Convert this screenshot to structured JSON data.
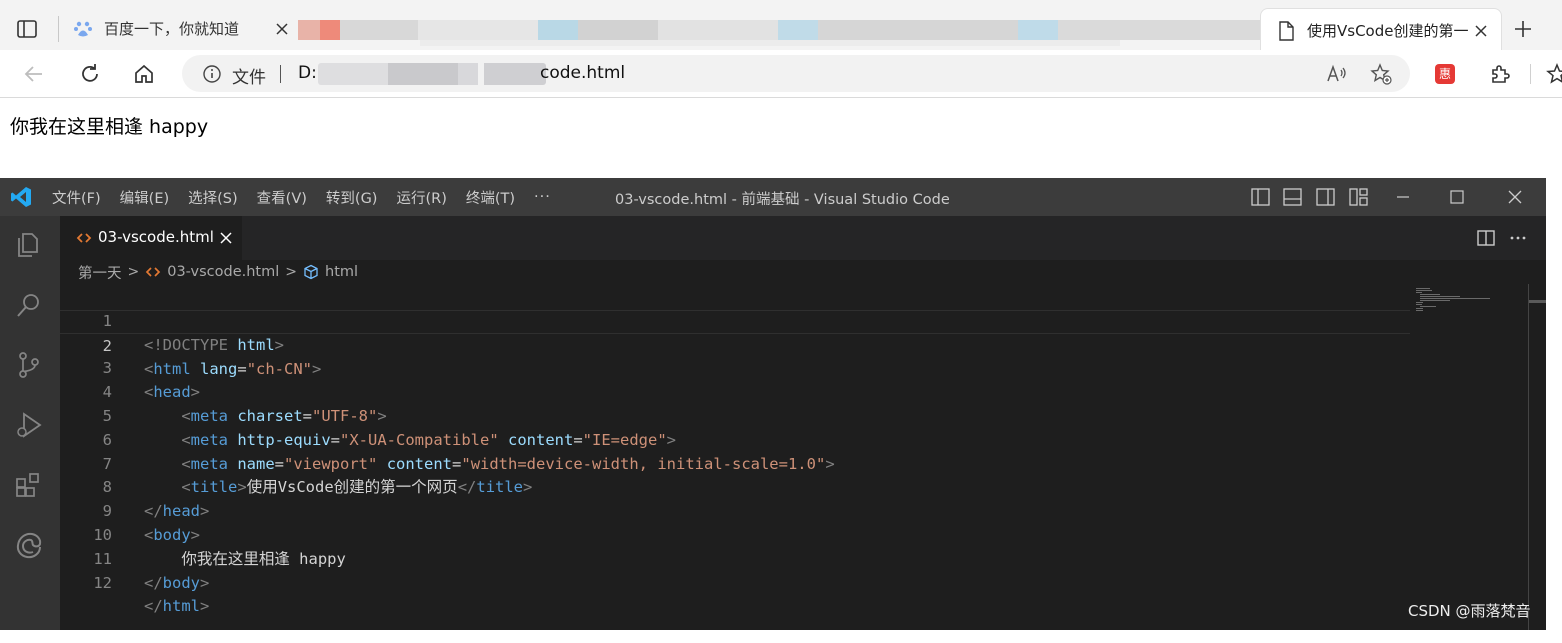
{
  "browser": {
    "tabs": [
      {
        "title": "百度一下，你就知道",
        "icon": "baidu-paw-icon"
      },
      {
        "title": "使用VsCode创建的第一",
        "icon": "page-icon",
        "active": true
      }
    ],
    "address": {
      "file_label": "文件",
      "url_prefix": "D:",
      "url_suffix": "code.html"
    },
    "extension_badge": "惠",
    "page_body_text": "你我在这里相逢 happy"
  },
  "vscode": {
    "menu": [
      "文件(F)",
      "编辑(E)",
      "选择(S)",
      "查看(V)",
      "转到(G)",
      "运行(R)",
      "终端(T)"
    ],
    "more": "···",
    "window_title": "03-vscode.html - 前端基础 - Visual Studio Code",
    "active_tab": "03-vscode.html",
    "breadcrumbs": {
      "folder": "第一天",
      "file": "03-vscode.html",
      "symbol": "html"
    },
    "title_charset": "UTF-8",
    "code_lines": [
      {
        "n": "1"
      },
      {
        "n": "2"
      },
      {
        "n": "3"
      },
      {
        "n": "4"
      },
      {
        "n": "5"
      },
      {
        "n": "6"
      },
      {
        "n": "7"
      },
      {
        "n": "8"
      },
      {
        "n": "9"
      },
      {
        "n": "10"
      },
      {
        "n": "11"
      },
      {
        "n": "12"
      }
    ],
    "tokens": {
      "doctype": "<!DOCTYPE",
      "html_kw": "html",
      "lang_attr": "lang",
      "lang_val": "\"ch-CN\"",
      "head": "head",
      "meta": "meta",
      "charset_attr": "charset",
      "charset_val": "\"UTF-8\"",
      "http_equiv_attr": "http-equiv",
      "http_equiv_val": "\"X-UA-Compatible\"",
      "content_attr": "content",
      "content_val1": "\"IE=edge\"",
      "name_attr": "name",
      "name_val": "\"viewport\"",
      "content_val2": "\"width=device-width, initial-scale=1.0\"",
      "title_tag": "title",
      "title_text": "使用VsCode创建的第一个网页",
      "body": "body",
      "body_text": "你我在这里相逢 happy"
    }
  },
  "watermark": "CSDN @雨落梵音",
  "colors": {
    "tag": "#569cd6",
    "attr": "#9cdcfe",
    "string": "#ce9178",
    "bracket": "#808080",
    "vscode_blue": "#23a9f2"
  }
}
